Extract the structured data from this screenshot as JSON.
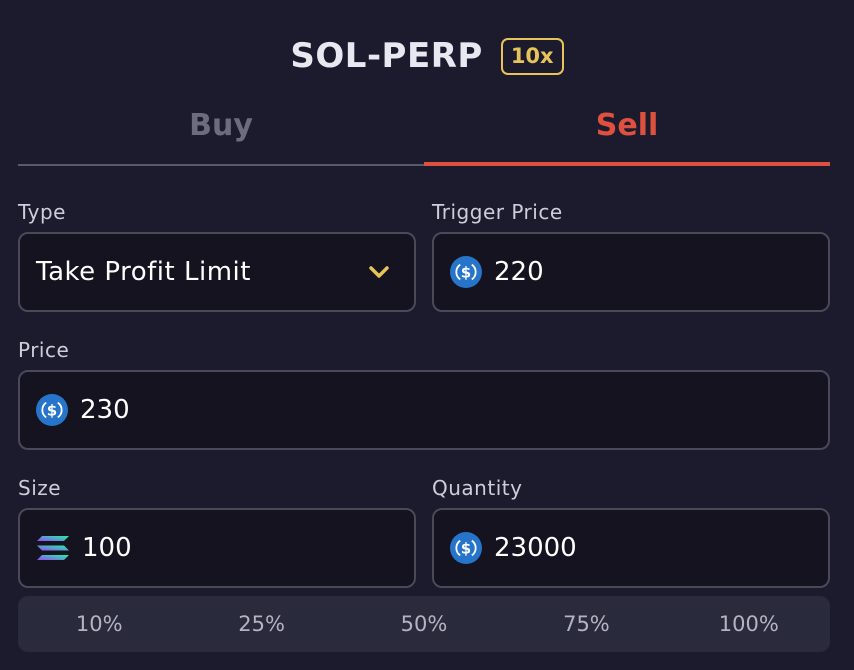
{
  "header": {
    "market": "SOL-PERP",
    "leverage": "10x"
  },
  "tabs": {
    "buy": "Buy",
    "sell": "Sell",
    "active": "Sell",
    "active_color": "#e0503f"
  },
  "form": {
    "type": {
      "label": "Type",
      "value": "Take Profit Limit"
    },
    "trigger_price": {
      "label": "Trigger Price",
      "value": "220",
      "icon": "usdc-icon"
    },
    "price": {
      "label": "Price",
      "value": "230",
      "icon": "usdc-icon"
    },
    "size": {
      "label": "Size",
      "value": "100",
      "icon": "sol-icon"
    },
    "quantity": {
      "label": "Quantity",
      "value": "23000",
      "icon": "usdc-icon"
    }
  },
  "percentages": [
    "10%",
    "25%",
    "50%",
    "75%",
    "100%"
  ],
  "colors": {
    "accent": "#e8c35a",
    "sell": "#e0503f",
    "background": "#1c1b2e",
    "input_background": "#14131f",
    "usdc_blue": "#2775ca"
  }
}
